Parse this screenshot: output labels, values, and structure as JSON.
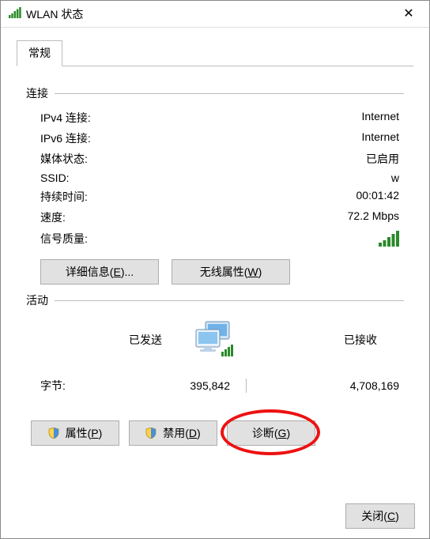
{
  "window": {
    "title": "WLAN 状态"
  },
  "tabs": {
    "general": "常规"
  },
  "groups": {
    "connection": "连接",
    "activity": "活动"
  },
  "conn": {
    "ipv4_label": "IPv4 连接:",
    "ipv4_value": "Internet",
    "ipv6_label": "IPv6 连接:",
    "ipv6_value": "Internet",
    "media_label": "媒体状态:",
    "media_value": "已启用",
    "ssid_label": "SSID:",
    "ssid_value": "w",
    "dur_label": "持续时间:",
    "dur_value": "00:01:42",
    "speed_label": "速度:",
    "speed_value": "72.2 Mbps",
    "signal_label": "信号质量:"
  },
  "buttons": {
    "details_pre": "详细信息(",
    "details_key": "E",
    "details_post": ")...",
    "wprops_pre": "无线属性(",
    "wprops_key": "W",
    "wprops_post": ")",
    "props_pre": "属性(",
    "props_key": "P",
    "props_post": ")",
    "disable_pre": "禁用(",
    "disable_key": "D",
    "disable_post": ")",
    "diag_pre": "诊断(",
    "diag_key": "G",
    "diag_post": ")",
    "close_pre": "关闭(",
    "close_key": "C",
    "close_post": ")"
  },
  "activity": {
    "sent_label": "已发送",
    "recv_label": "已接收",
    "bytes_label": "字节:",
    "bytes_sent": "395,842",
    "bytes_recv": "4,708,169"
  }
}
